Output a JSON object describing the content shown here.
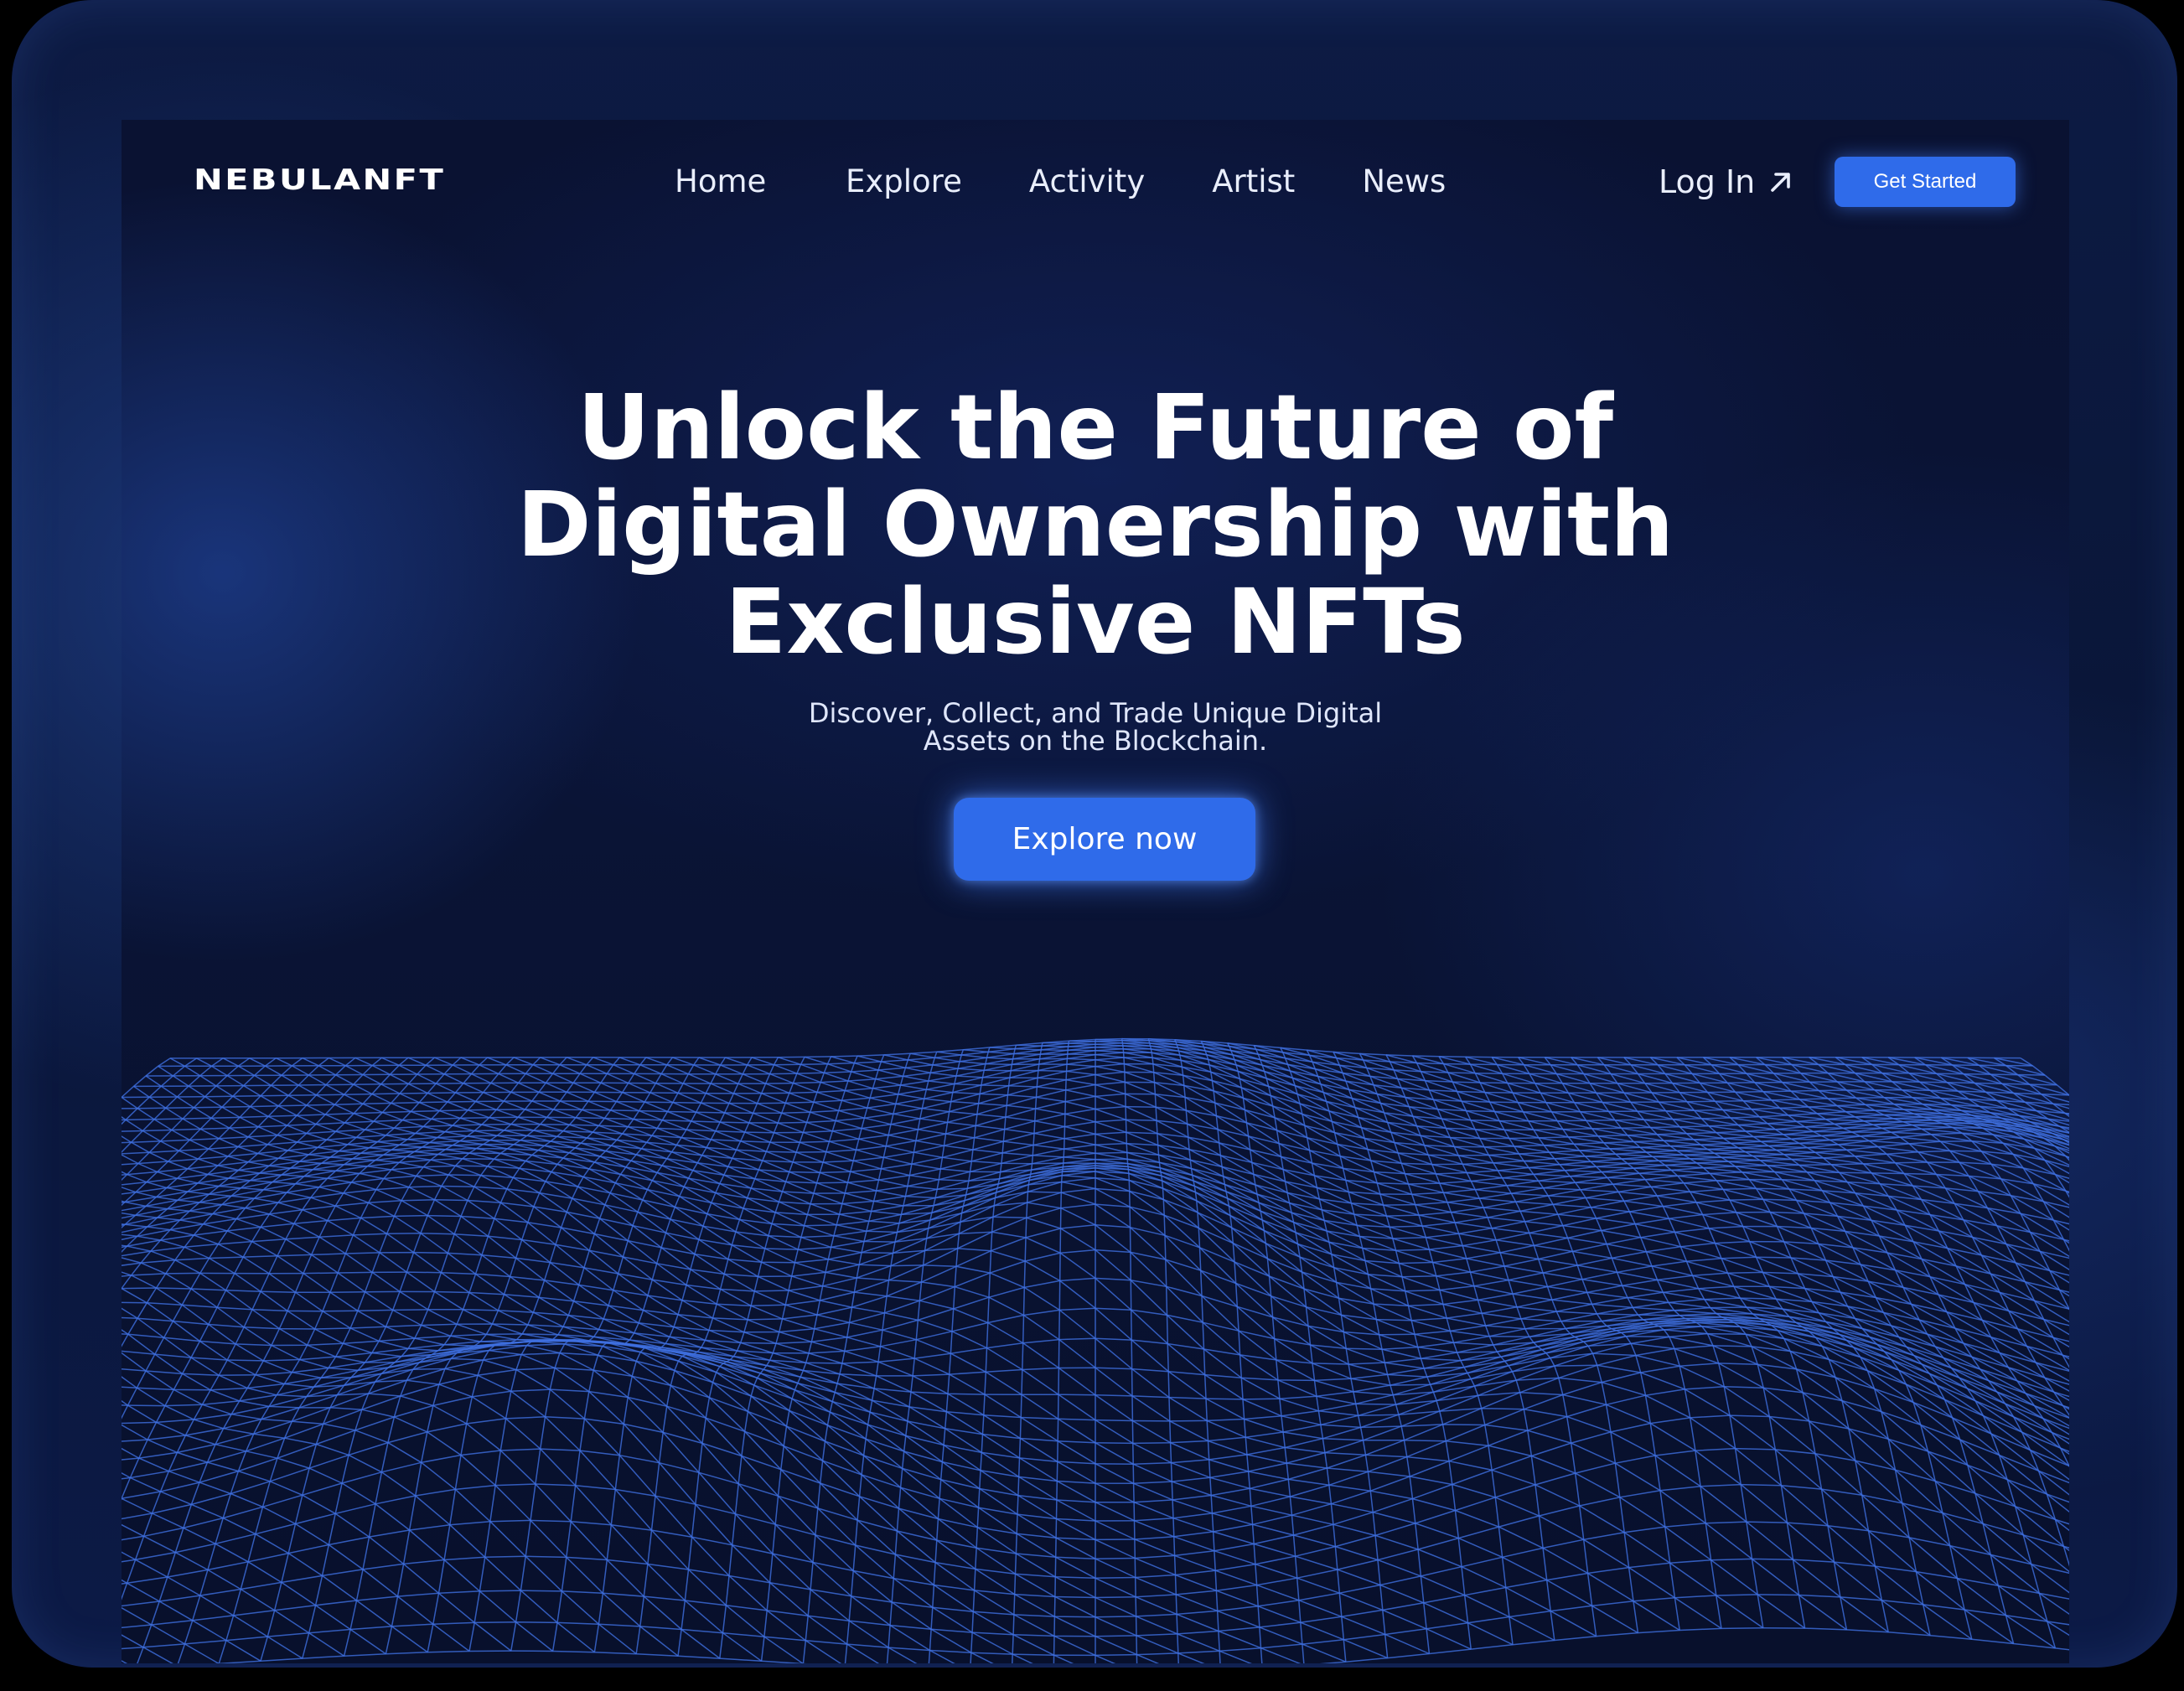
{
  "brand": {
    "name": "NEBULANFT"
  },
  "nav": {
    "items": [
      {
        "label": "Home"
      },
      {
        "label": "Explore"
      },
      {
        "label": "Activity"
      },
      {
        "label": "Artist"
      },
      {
        "label": "News"
      }
    ],
    "login_label": "Log In",
    "login_icon": "arrow-up-right-icon",
    "get_started_label": "Get Started"
  },
  "hero": {
    "title_line1": "Unlock the Future of",
    "title_line2": "Digital Ownership with",
    "title_line3": "Exclusive NFTs",
    "subtitle_line1": "Discover, Collect, and Trade Unique Digital",
    "subtitle_line2": "Assets on the Blockchain.",
    "cta_label": "Explore now"
  },
  "colors": {
    "accent": "#2f6bea",
    "background": "#0a1436",
    "wireframe": "#3f6fe0",
    "text": "#ffffff"
  }
}
